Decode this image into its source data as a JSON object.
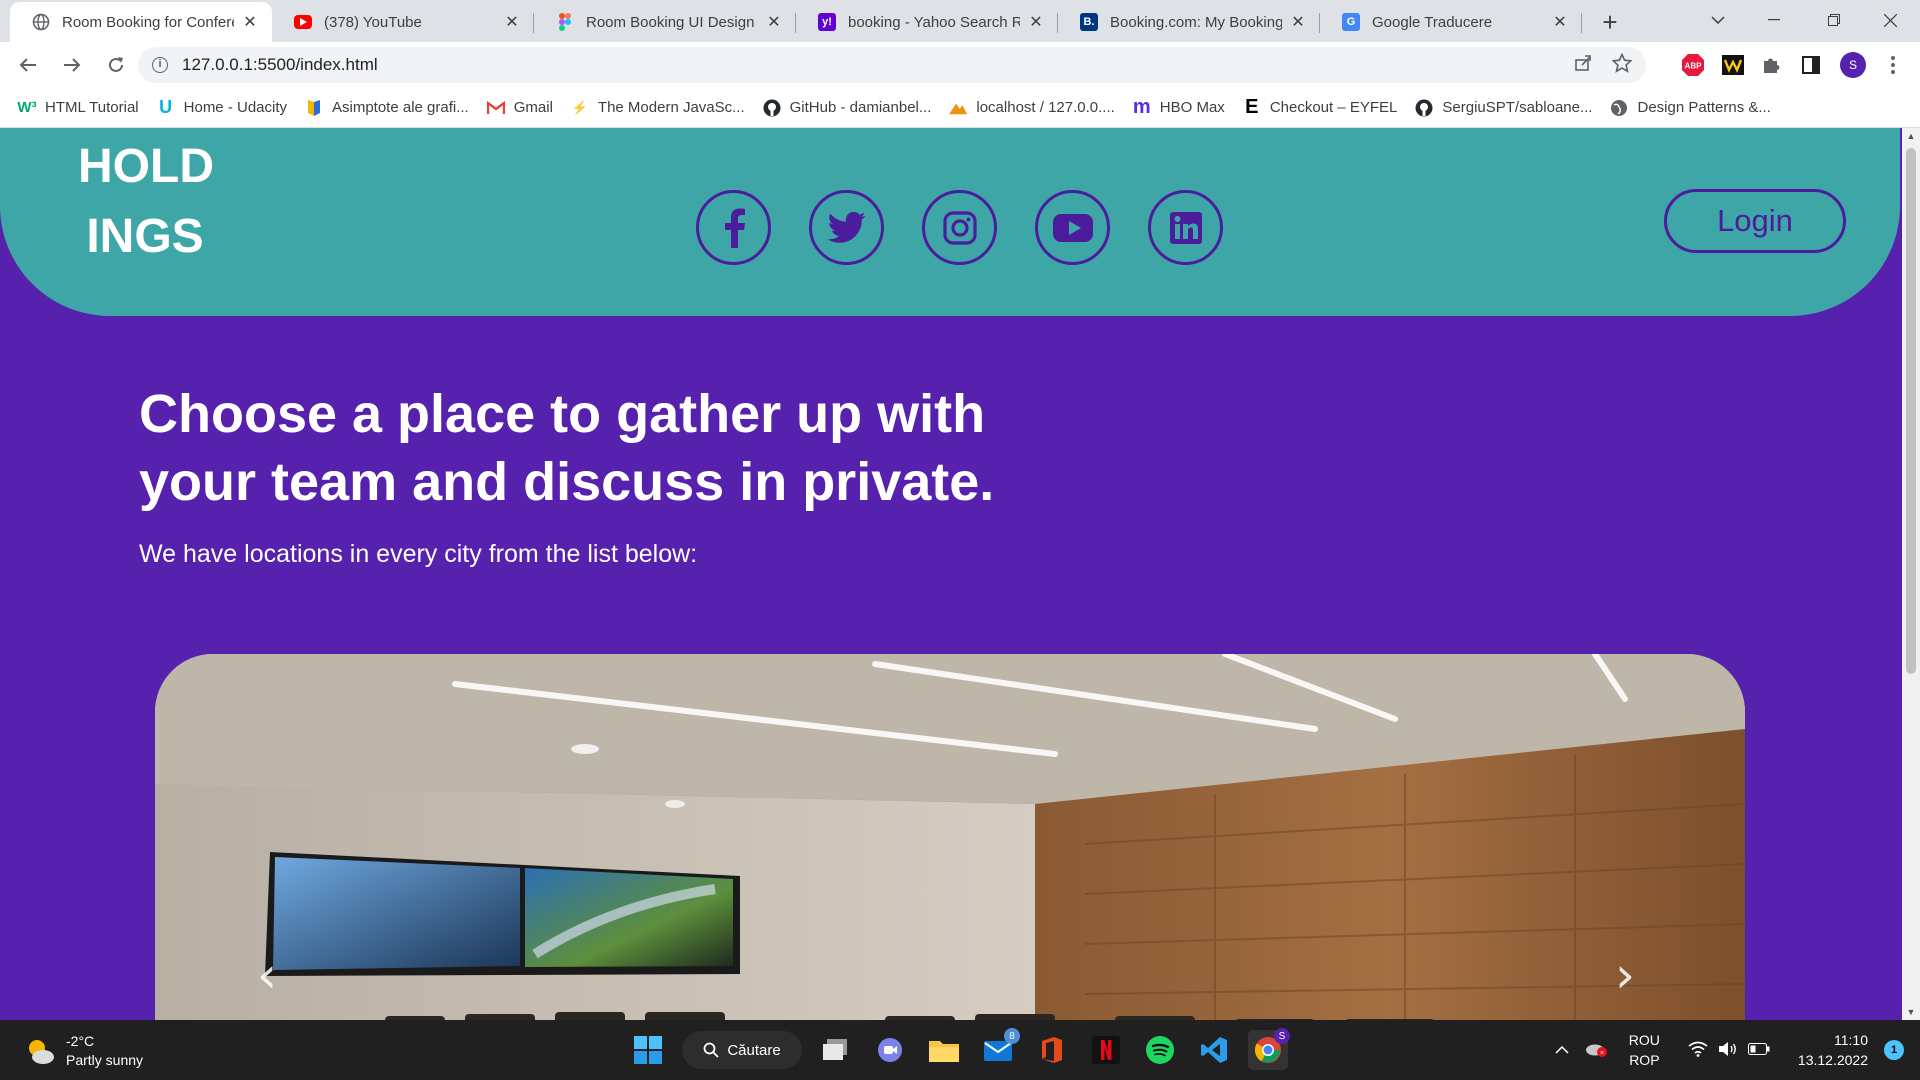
{
  "browser": {
    "tabs": [
      {
        "title": "Room Booking for Conferen",
        "icon": "globe-icon",
        "active": true
      },
      {
        "title": "(378) YouTube",
        "icon": "youtube-icon"
      },
      {
        "title": "Room Booking UI Design –",
        "icon": "figma-icon"
      },
      {
        "title": "booking - Yahoo Search Re",
        "icon": "yahoo-icon"
      },
      {
        "title": "Booking.com: My Booking.c",
        "icon": "booking-icon"
      },
      {
        "title": "Google Traducere",
        "icon": "google-translate-icon"
      }
    ],
    "url": "127.0.0.1:5500/index.html",
    "profile_initial": "S",
    "extensions": {
      "abp": "ABP"
    },
    "bookmarks": [
      {
        "label": "HTML Tutorial",
        "icon": "w3schools-icon"
      },
      {
        "label": "Home - Udacity",
        "icon": "udacity-icon"
      },
      {
        "label": "Asimptote ale grafi...",
        "icon": "bookmark-icon"
      },
      {
        "label": "Gmail",
        "icon": "gmail-icon"
      },
      {
        "label": "The Modern JavaSc...",
        "icon": "javascript-info-icon"
      },
      {
        "label": "GitHub - damianbel...",
        "icon": "github-icon"
      },
      {
        "label": "localhost / 127.0.0....",
        "icon": "phpmyadmin-icon"
      },
      {
        "label": "HBO Max",
        "icon": "hbo-icon"
      },
      {
        "label": "Checkout – EYFEL",
        "icon": "eyfel-icon"
      },
      {
        "label": "SergiuSPT/sabloane...",
        "icon": "github-icon"
      },
      {
        "label": "Design Patterns &...",
        "icon": "globe-icon"
      }
    ]
  },
  "page": {
    "logo_line1": "HOLD",
    "logo_line2": "INGS",
    "socials": [
      "facebook-icon",
      "twitter-icon",
      "instagram-icon",
      "youtube-icon",
      "linkedin-icon"
    ],
    "login_label": "Login",
    "hero_title": "Choose a place to gather up with your team and discuss in private.",
    "hero_subtitle": "We have locations in every city from the list below:",
    "carousel_prev": "‹",
    "carousel_next": "›",
    "colors": {
      "page_bg": "#5621ad",
      "header_bg": "#3ea6a6",
      "accent": "#4b1c9c"
    }
  },
  "taskbar": {
    "temperature": "-2°C",
    "weather": "Partly sunny",
    "search_label": "Căutare",
    "mail_badge": "8",
    "chrome_badge": "S",
    "lang_line1": "ROU",
    "lang_line2": "ROP",
    "time": "11:10",
    "date": "13.12.2022",
    "notifications": "1"
  }
}
